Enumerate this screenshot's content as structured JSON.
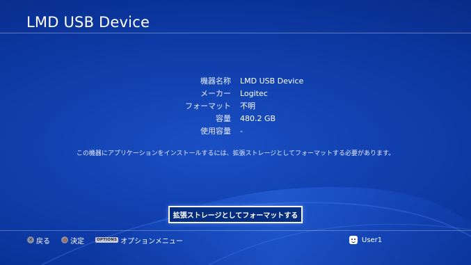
{
  "title": "LMD USB Device",
  "device_info": [
    {
      "label": "機器名称",
      "value": "LMD USB Device"
    },
    {
      "label": "メーカー",
      "value": "Logitec"
    },
    {
      "label": "フォーマット",
      "value": "不明"
    },
    {
      "label": "容量",
      "value": "480.2 GB"
    },
    {
      "label": "使用容量",
      "value": "-"
    }
  ],
  "message": "この機器にアプリケーションをインストールするには、拡張ストレージとしてフォーマットする必要があります。",
  "format_button_label": "拡張ストレージとしてフォーマットする",
  "footer": {
    "back_label": "戻る",
    "confirm_label": "決定",
    "options_badge": "OPTIONS",
    "options_label": "オプションメニュー",
    "user_name": "User1"
  },
  "colors": {
    "background_main": "#0d3aa5",
    "background_dark": "#051f6b",
    "button_border": "#ffffff"
  },
  "icons": {
    "back": "cross-button-icon",
    "confirm": "circle-button-icon",
    "user": "user-avatar-icon"
  }
}
